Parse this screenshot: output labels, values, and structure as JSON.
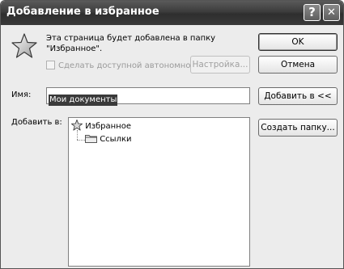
{
  "window": {
    "title": "Добавление в избранное",
    "help_button": "?",
    "close_button": "✕"
  },
  "message": {
    "line1": "Эта страница будет добавлена в папку",
    "line2": "\"Избранное\"."
  },
  "offline": {
    "checkbox_label": "Сделать доступной автономно",
    "checked": false,
    "settings_button": "Настройка..."
  },
  "buttons": {
    "ok": "OK",
    "cancel": "Отмена",
    "add_to": "Добавить в <<",
    "new_folder": "Создать папку..."
  },
  "name_field": {
    "label": "Имя:",
    "value": "Мои документы"
  },
  "folder_tree": {
    "label": "Добавить в:",
    "root": "Избранное",
    "children": [
      "Ссылки"
    ]
  },
  "icons": {
    "header": "star-icon",
    "root": "star-icon",
    "child": "folder-icon"
  }
}
